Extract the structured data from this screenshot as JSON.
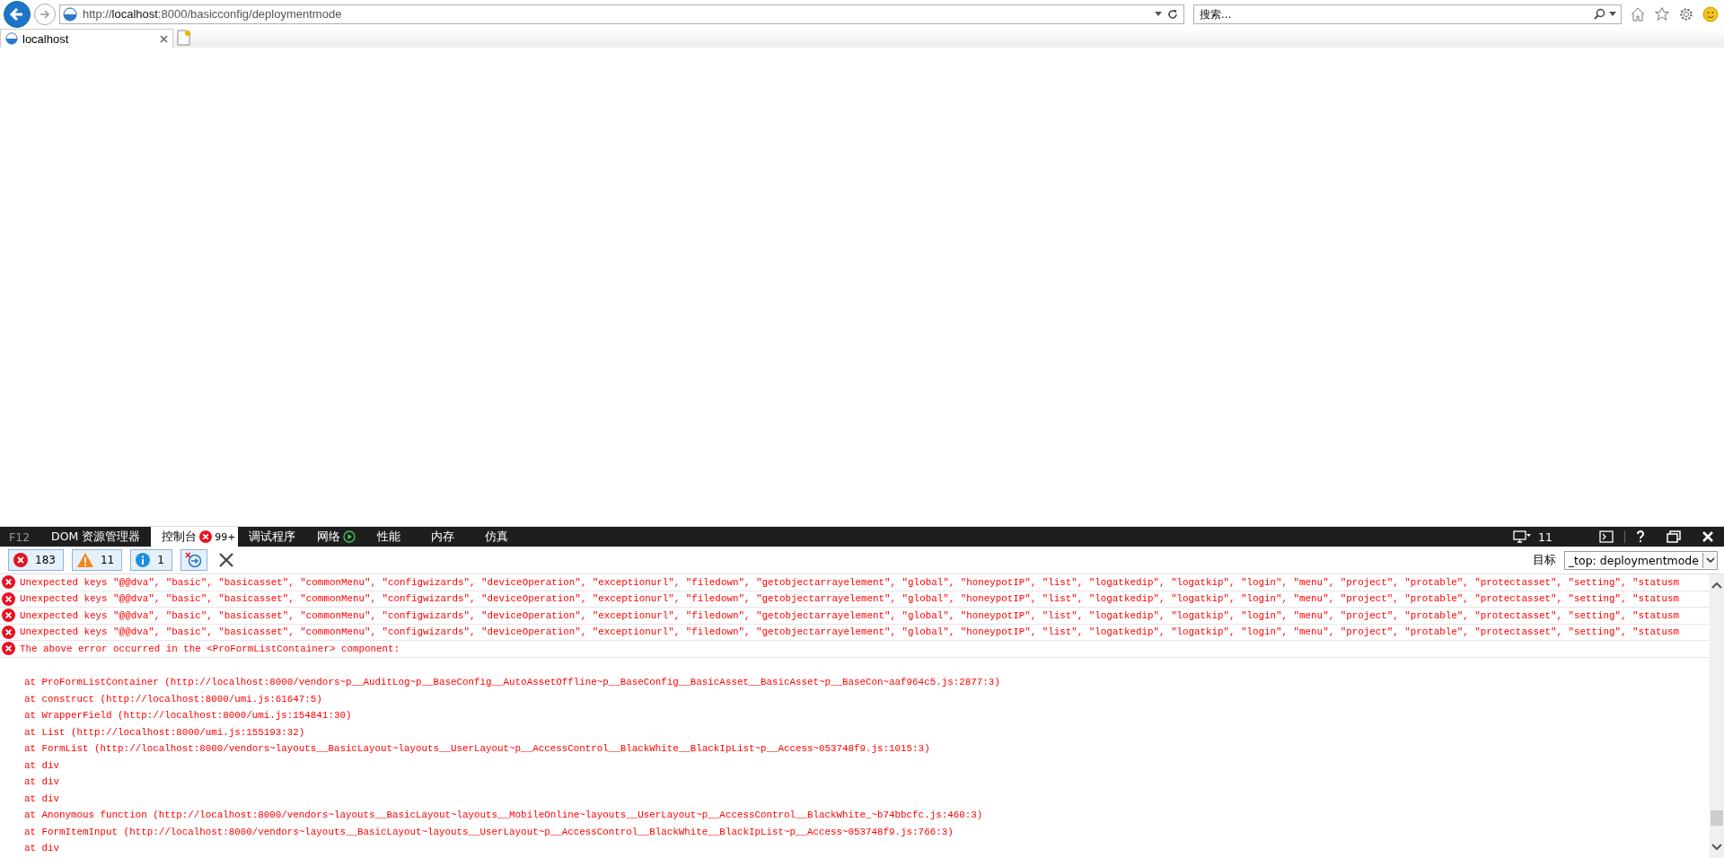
{
  "browser": {
    "address": "http://**localhost**:8000/basicconfig/deploymentmode",
    "search_placeholder": "搜索...",
    "tabs": [
      {
        "label": "localhost",
        "selected": true
      }
    ]
  },
  "devtools": {
    "tabs": [
      {
        "label": "F12",
        "kind": "caption"
      },
      {
        "label": "DOM 资源管理器",
        "kind": "tab",
        "selected": false
      },
      {
        "label": "控制台",
        "kind": "tab",
        "selected": true,
        "badge": "99+"
      },
      {
        "label": "调试程序",
        "kind": "tab",
        "selected": false
      },
      {
        "label": "网络",
        "kind": "network",
        "selected": false
      },
      {
        "label": "性能",
        "kind": "tab",
        "selected": false
      },
      {
        "label": "内存",
        "kind": "tab",
        "selected": false
      },
      {
        "label": "仿真",
        "kind": "tab",
        "selected": false
      }
    ],
    "document_mode": "11",
    "filters": [
      {
        "kind": "error",
        "count": "183",
        "on": true
      },
      {
        "kind": "warning",
        "count": "11",
        "on": true
      },
      {
        "kind": "info",
        "count": "1",
        "on": true
      }
    ],
    "target_label": "目标",
    "target_value": "_top: deploymentmode",
    "console": [
      {
        "kind": "error",
        "text": "Unexpected keys \"@@dva\", \"basic\", \"basicasset\", \"commonMenu\", \"configwizards\", \"deviceOperation\", \"exceptionurl\", \"filedown\", \"getobjectarrayelement\", \"global\", \"honeypotIP\", \"list\", \"logatkedip\", \"logatkip\", \"login\", \"menu\", \"project\", \"protable\", \"protectasset\", \"setting\", \"statusm"
      },
      {
        "kind": "error",
        "text": "Unexpected keys \"@@dva\", \"basic\", \"basicasset\", \"commonMenu\", \"configwizards\", \"deviceOperation\", \"exceptionurl\", \"filedown\", \"getobjectarrayelement\", \"global\", \"honeypotIP\", \"list\", \"logatkedip\", \"logatkip\", \"login\", \"menu\", \"project\", \"protable\", \"protectasset\", \"setting\", \"statusm"
      },
      {
        "kind": "error",
        "text": "Unexpected keys \"@@dva\", \"basic\", \"basicasset\", \"commonMenu\", \"configwizards\", \"deviceOperation\", \"exceptionurl\", \"filedown\", \"getobjectarrayelement\", \"global\", \"honeypotIP\", \"list\", \"logatkedip\", \"logatkip\", \"login\", \"menu\", \"project\", \"protable\", \"protectasset\", \"setting\", \"statusm"
      },
      {
        "kind": "error",
        "text": "Unexpected keys \"@@dva\", \"basic\", \"basicasset\", \"commonMenu\", \"configwizards\", \"deviceOperation\", \"exceptionurl\", \"filedown\", \"getobjectarrayelement\", \"global\", \"honeypotIP\", \"list\", \"logatkedip\", \"logatkip\", \"login\", \"menu\", \"project\", \"protable\", \"protectasset\", \"setting\", \"statusm"
      },
      {
        "kind": "error",
        "text": "The above error occurred in the <ProFormListContainer> component:"
      },
      {
        "kind": "blank"
      },
      {
        "kind": "trace",
        "text": "at ProFormListContainer (http://localhost:8000/vendors~p__AuditLog~p__BaseConfig__AutoAssetOffline~p__BaseConfig__BasicAsset__BasicAsset~p__BaseCon~aaf964c5.js:2877:3)"
      },
      {
        "kind": "trace",
        "text": "at construct (http://localhost:8000/umi.js:61647:5)"
      },
      {
        "kind": "trace",
        "text": "at WrapperField (http://localhost:8000/umi.js:154841:30)"
      },
      {
        "kind": "trace",
        "text": "at List (http://localhost:8000/umi.js:155193:32)"
      },
      {
        "kind": "trace",
        "text": "at FormList (http://localhost:8000/vendors~layouts__BasicLayout~layouts__UserLayout~p__AccessControl__BlackWhite__BlackIpList~p__Access~053748f9.js:1015:3)"
      },
      {
        "kind": "trace",
        "text": "at div"
      },
      {
        "kind": "trace",
        "text": "at div"
      },
      {
        "kind": "trace",
        "text": "at div"
      },
      {
        "kind": "trace",
        "text": "at Anonymous function (http://localhost:8000/vendors~layouts__BasicLayout~layouts__MobileOnline~layouts__UserLayout~p__AccessControl__BlackWhite_~b74bbcfc.js:460:3)"
      },
      {
        "kind": "trace",
        "text": "at FormItemInput (http://localhost:8000/vendors~layouts__BasicLayout~layouts__UserLayout~p__AccessControl__BlackWhite__BlackIpList~p__Access~053748f9.js:766:3)"
      },
      {
        "kind": "trace",
        "text": "at div"
      }
    ]
  }
}
